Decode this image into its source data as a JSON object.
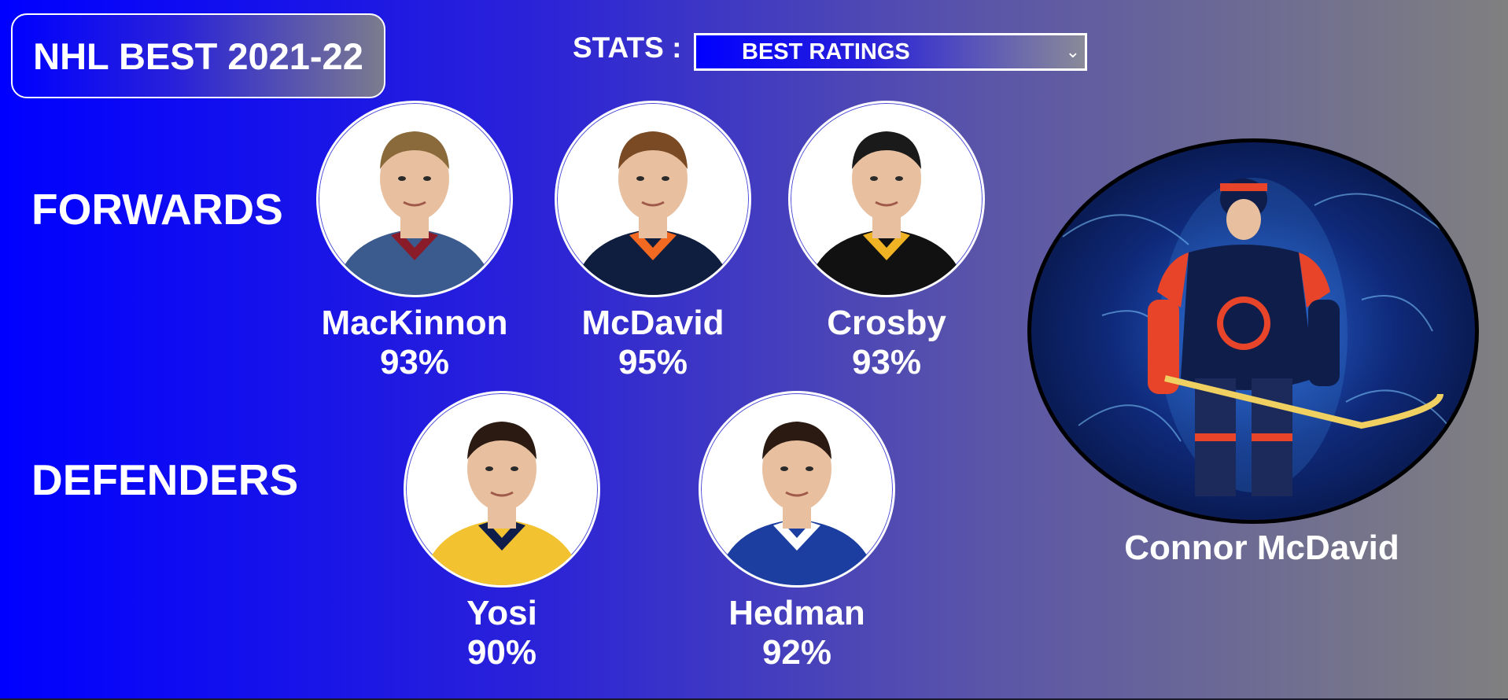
{
  "app_title": "NHL BEST 2021-22",
  "stats": {
    "label": "STATS :",
    "selected": "BEST RATINGS"
  },
  "sections": {
    "forwards": "FORWARDS",
    "defenders": "DEFENDERS"
  },
  "forwards": [
    {
      "name": "MacKinnon",
      "rating": "93%",
      "jersey_color": "#3b5b8e",
      "accent_color": "#8a1c2a"
    },
    {
      "name": "McDavid",
      "rating": "95%",
      "jersey_color": "#0f1d3f",
      "accent_color": "#f26a21"
    },
    {
      "name": "Crosby",
      "rating": "93%",
      "jersey_color": "#111111",
      "accent_color": "#f0b323"
    }
  ],
  "defenders": [
    {
      "name": "Yosi",
      "rating": "90%",
      "jersey_color": "#f2c230",
      "accent_color": "#0f1d4a"
    },
    {
      "name": "Hedman",
      "rating": "92%",
      "jersey_color": "#1b3ea0",
      "accent_color": "#ffffff"
    }
  ],
  "featured": {
    "name": "Connor McDavid",
    "jersey_color": "#0f1d4a",
    "accent_color": "#e8442a"
  },
  "icons": {
    "dropdown": "chevron-down-icon"
  }
}
